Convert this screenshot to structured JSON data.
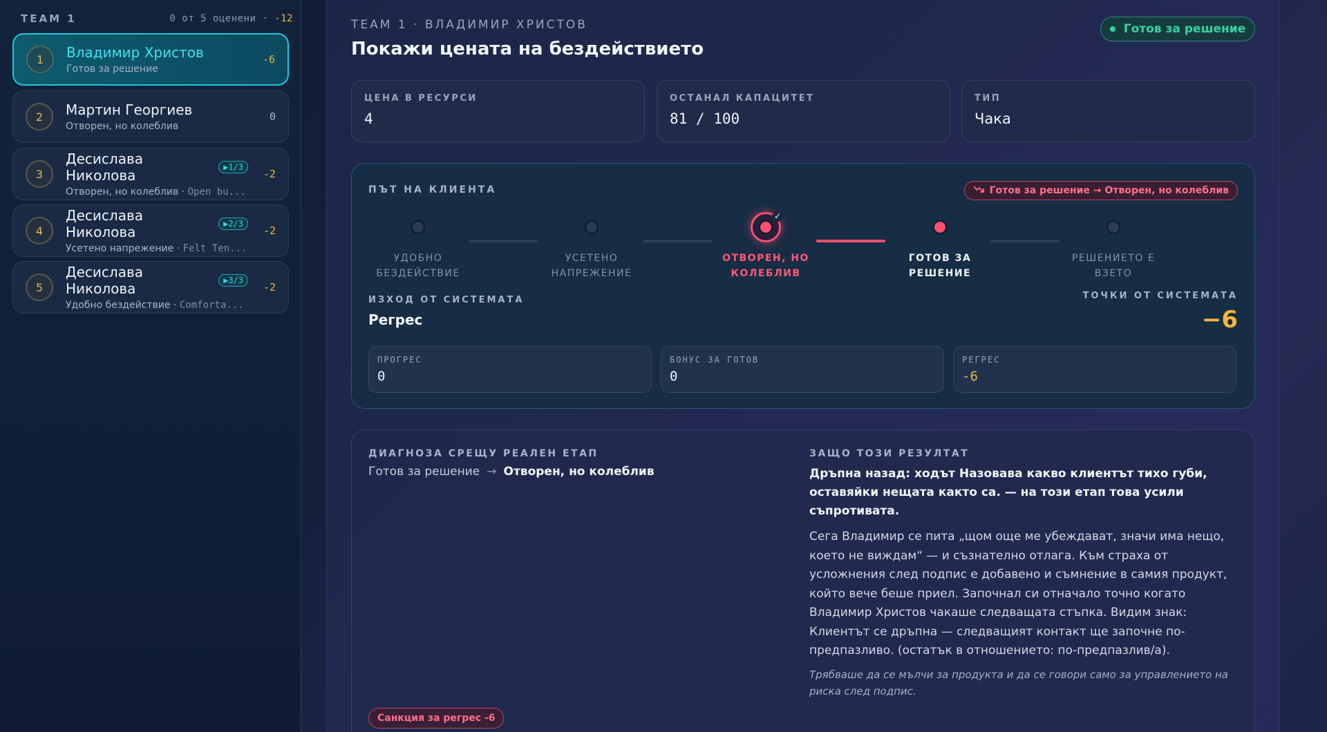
{
  "sidebar": {
    "title": "TEAM 1",
    "meta_prefix": "0 от 5 оценени ·",
    "meta_score": "-12",
    "items": [
      {
        "num": "1",
        "name": "Владимир Христов",
        "status": "Готов за решение",
        "score": "-6"
      },
      {
        "num": "2",
        "name": "Мартин Георгиев",
        "status": "Отворен, но колеблив",
        "score": "0"
      },
      {
        "num": "3",
        "name": "Десислава Николова",
        "pill": "▶1/3",
        "status": "Отворен, но колеблив",
        "hint": "Open bu...",
        "score": "-2"
      },
      {
        "num": "4",
        "name": "Десислава Николова",
        "pill": "▶2/3",
        "status": "Усетено напрежение",
        "hint": "Felt Ten...",
        "score": "-2"
      },
      {
        "num": "5",
        "name": "Десислава Николова",
        "pill": "▶3/3",
        "status": "Удобно бездействие",
        "hint": "Comforta...",
        "score": "-2"
      }
    ]
  },
  "header": {
    "crumb": "TEAM 1 · ВЛАДИМИР ХРИСТОВ",
    "title": "Покажи цената на бездействието",
    "status": "Готов за решение",
    "status_color": "#36d39f"
  },
  "kpis": [
    {
      "label": "ЦЕНА В РЕСУРСИ",
      "value": "4"
    },
    {
      "label": "ОСТАНАЛ КАПАЦИТЕТ",
      "value": "81 / 100"
    },
    {
      "label": "ТИП",
      "value": "Чака"
    }
  ],
  "journey": {
    "label": "ПЪТ НА КЛИЕНТА",
    "badge": "Готов за решение → Отворен, но колеблив",
    "badge_icon": "trend-down-icon",
    "steps": [
      {
        "l1": "УДОБНО",
        "l2": "БЕЗДЕЙСТВИЕ"
      },
      {
        "l1": "УСЕТЕНО",
        "l2": "НАПРЕЖЕНИЕ"
      },
      {
        "l1": "ОТВОРЕН, НО",
        "l2": "КОЛЕБЛИВ"
      },
      {
        "l1": "ГОТОВ ЗА",
        "l2": "РЕШЕНИЕ"
      },
      {
        "l1": "РЕШЕНИЕТО Е",
        "l2": "ВЗЕТО"
      }
    ],
    "exit_label": "ИЗХОД ОТ СИСТЕМАТА",
    "exit_value": "Регрес",
    "points_label": "ТОЧКИ ОТ СИСТЕМАТА",
    "points_value": "−6",
    "subs": [
      {
        "label": "ПРОГРЕС",
        "value": "0"
      },
      {
        "label": "БОНУС ЗА ГОТОВ",
        "value": "0"
      },
      {
        "label": "РЕГРЕС",
        "value": "-6"
      }
    ],
    "accent": "#ff4f6e"
  },
  "diagnosis": {
    "label": "ДИАГНОЗА СРЕЩУ РЕАЛЕН ЕТАП",
    "from": "Готов за решение",
    "to": "Отворен, но колеблив",
    "why_label": "ЗАЩО ТОЗИ РЕЗУЛТАТ",
    "why_bold": "Дръпна назад: ходът Назовава какво клиентът тихо губи, оставяйки нещата както са. — на този етап това усили съпротивата.",
    "why_body": "Сега Владимир се пита „щом още ме убеждават, значи има нещо, което не виждам“ — и съзнателно отлага. Към страха от усложнения след подпис е добавено и съмнение в самия продукт, който вече беше приел. Започнал си отначало точно когато Владимир Христов чакаше следващата стъпка. Видим знак: Клиентът се дръпна — следващият контакт ще започне по-предпазливо. (остатък в отношението: по-предпазлив/а).",
    "why_note": "Трябваше да се мълчи за продукта и да се говори само за управлението на риска след подпис.",
    "penalty": "Санкция за регрес -6"
  }
}
